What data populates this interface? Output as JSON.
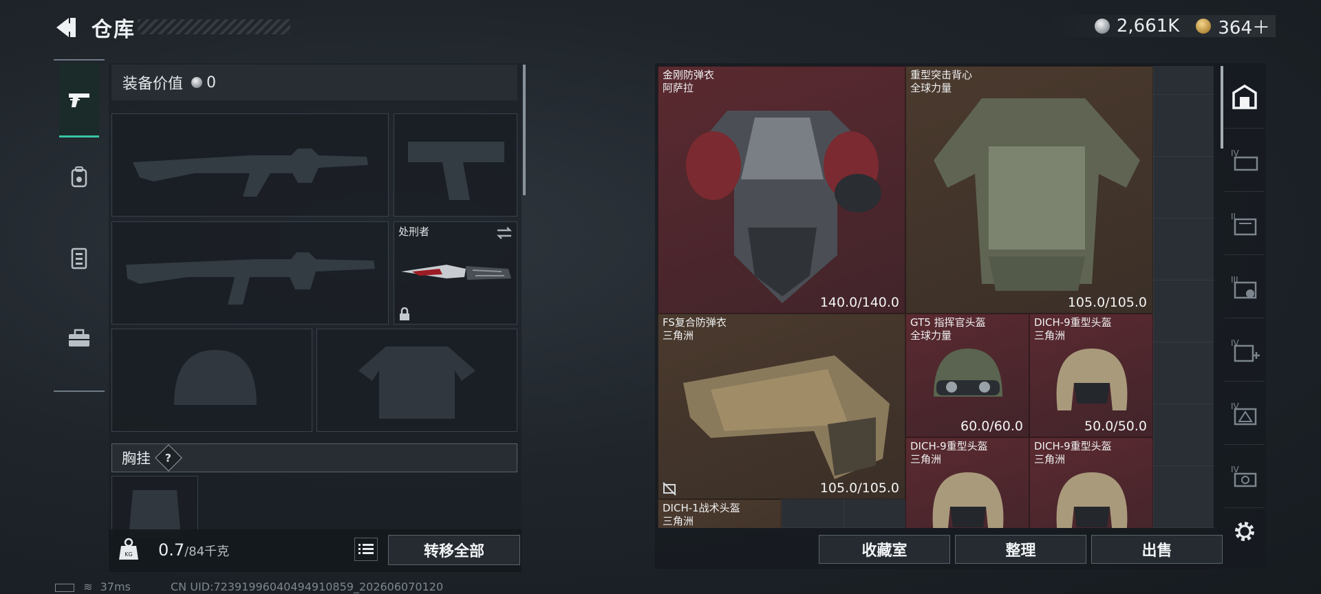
{
  "header": {
    "title": "仓库",
    "currency_silver": "2,661K",
    "currency_gold": "364＋"
  },
  "loadout": {
    "value_label": "装备价值",
    "value": "0",
    "melee_name": "处刑者",
    "chest_label": "胸挂",
    "chest_help": "?",
    "weight_current": "0.7",
    "weight_max": "/84千克",
    "transfer_all": "转移全部"
  },
  "left_nav": [
    "weapon-icon",
    "backpack-icon",
    "vest-icon",
    "toolbox-icon"
  ],
  "stash": {
    "items": [
      {
        "name": "金刚防弹衣\n阿萨拉",
        "durability": "140.0/140.0",
        "rarity": "red"
      },
      {
        "name": "重型突击背心\n全球力量",
        "durability": "105.0/105.0",
        "rarity": "gold"
      },
      {
        "name": "FS复合防弹衣\n三角洲",
        "durability": "105.0/105.0",
        "rarity": "gold"
      },
      {
        "name": "GT5 指挥官头盔\n全球力量",
        "durability": "60.0/60.0",
        "rarity": "red"
      },
      {
        "name": "DICH-9重型头盔\n三角洲",
        "durability": "50.0/50.0",
        "rarity": "red"
      },
      {
        "name": "DICH-9重型头盔\n三角洲",
        "durability": "",
        "rarity": "red"
      },
      {
        "name": "DICH-9重型头盔\n三角洲",
        "durability": "",
        "rarity": "red"
      },
      {
        "name": "DICH-1战术头盔\n三角洲",
        "durability": "",
        "rarity": "gold"
      }
    ],
    "buttons": {
      "collection": "收藏室",
      "organize": "整理",
      "sell": "出售"
    }
  },
  "right_nav": [
    "stash-home-icon",
    "tier-iv-storage-icon",
    "tier-ii-storage-icon",
    "tier-iii-storage-icon",
    "tier-iv-add-icon",
    "tier-iv-box-icon",
    "tier-iv-case-icon",
    "settings-gear-icon"
  ],
  "right_nav_labels": [
    "IV",
    "II",
    "III",
    "IV",
    "IV",
    "IV"
  ],
  "status": {
    "ping": "37ms",
    "uid": "CN UID:72391996040494910859_202606070120"
  },
  "colors": {
    "accent": "#39c6a8",
    "red_rarity": "#5a2a30",
    "gold_rarity": "#4b3a2e"
  }
}
